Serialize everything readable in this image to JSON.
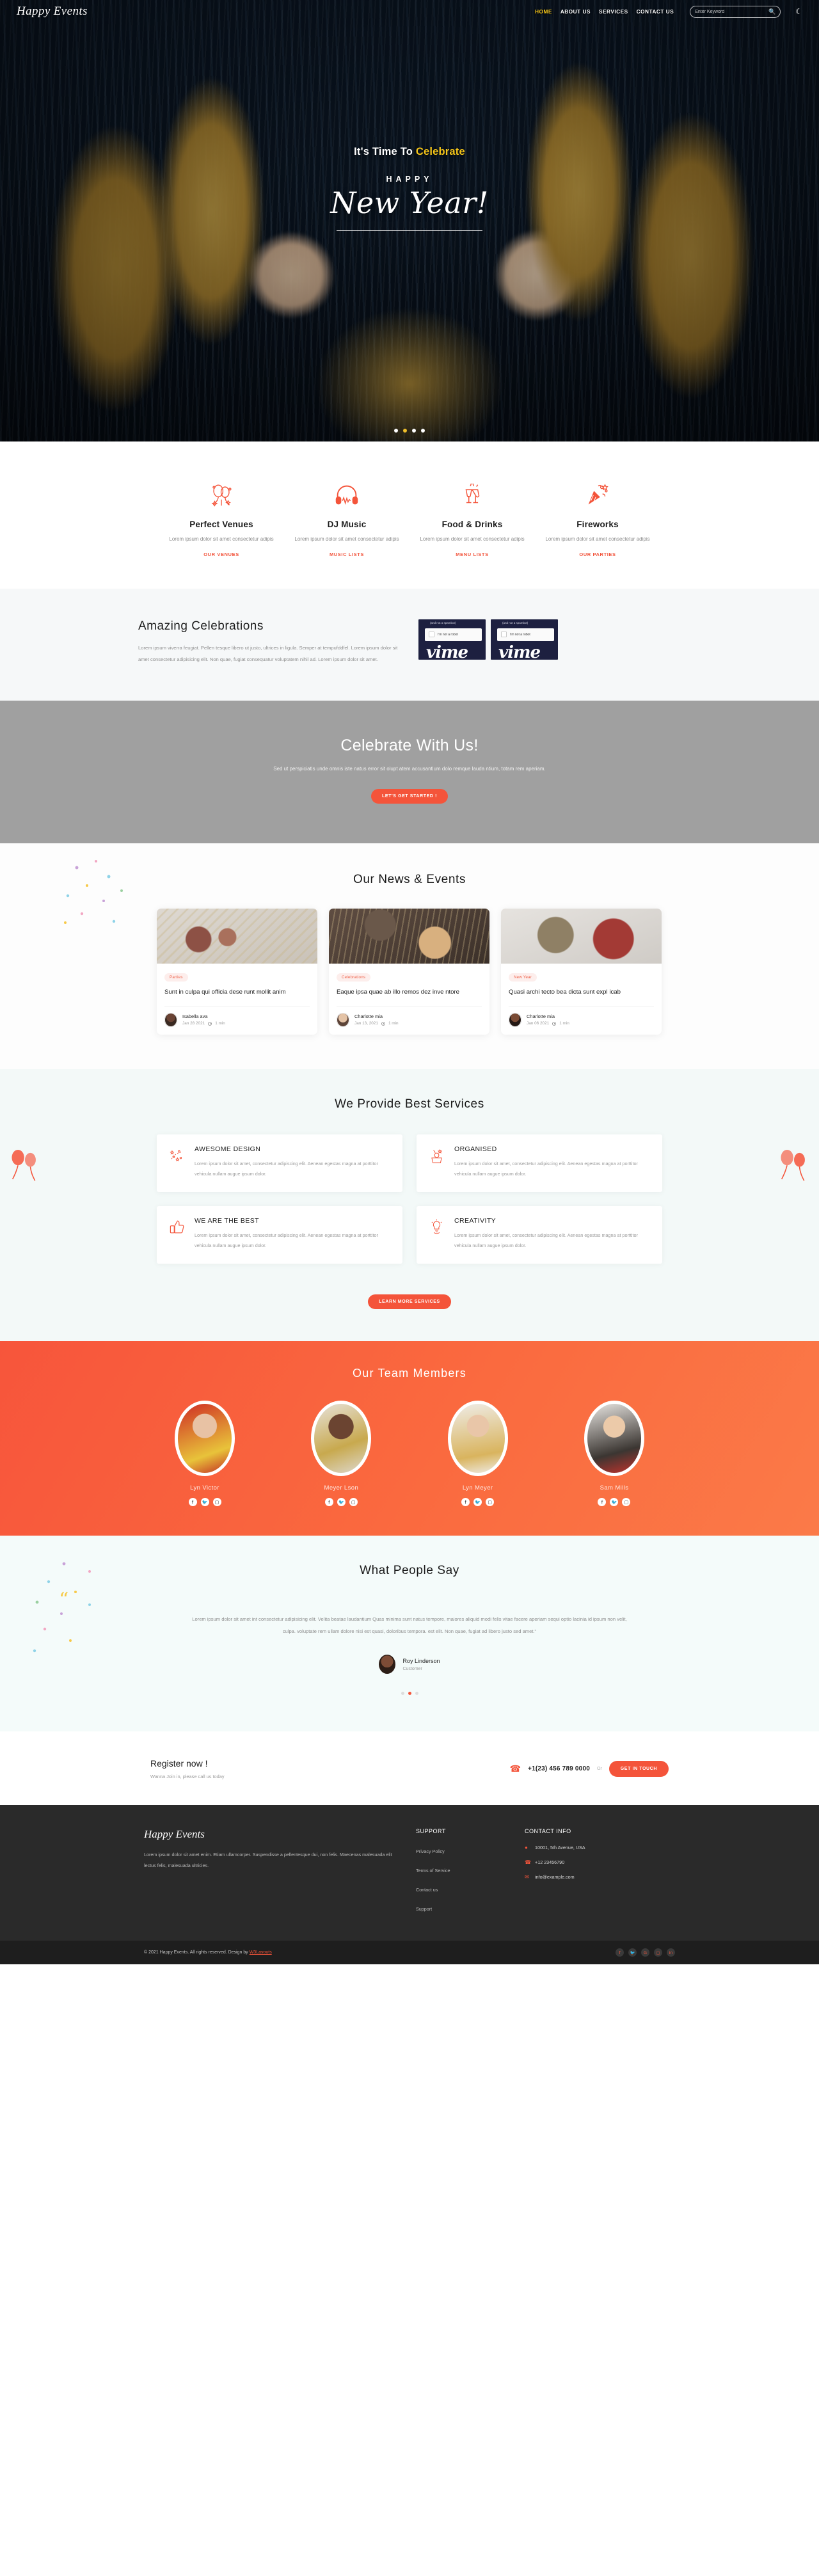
{
  "brand": {
    "name": "Happy Events",
    "accent": "#f4543a",
    "gold": "#f5c518"
  },
  "header": {
    "nav": [
      {
        "label": "HOME",
        "active": true
      },
      {
        "label": "ABOUT US",
        "active": false
      },
      {
        "label": "SERVICES",
        "active": false
      },
      {
        "label": "CONTACT US",
        "active": false
      }
    ],
    "search_placeholder": "Enter Keyword",
    "search_value": "",
    "search_icon": "search-icon",
    "theme_icon": "moon-icon"
  },
  "hero": {
    "eyebrow_pre": "It's Time To ",
    "eyebrow_accent": "Celebrate",
    "happy": "HAPPY",
    "title": "New Year!",
    "slide_count": 4,
    "active_slide": 2
  },
  "features": [
    {
      "icon": "balloons-icon",
      "title": "Perfect Venues",
      "text": "Lorem ipsum dolor sit amet consectetur adipis",
      "link": "OUR VENUES"
    },
    {
      "icon": "headphones-icon",
      "title": "DJ Music",
      "text": "Lorem ipsum dolor sit amet consectetur adipis",
      "link": "MUSIC LISTS"
    },
    {
      "icon": "champagne-glasses-icon",
      "title": "Food & Drinks",
      "text": "Lorem ipsum dolor sit amet consectetur adipis",
      "link": "MENU LISTS"
    },
    {
      "icon": "party-popper-icon",
      "title": "Fireworks",
      "text": "Lorem ipsum dolor sit amet consectetur adipis",
      "link": "OUR PARTIES"
    }
  ],
  "amazing": {
    "title": "Amazing Celebrations",
    "text": "Lorem ipsum viverra feugiat. Pellen tesque libero ut justo, ultrices in ligula. Semper at tempufddfel. Lorem ipsum dolor sit amet consectetur adipisicing elit. Non quae, fugiat consequatur voluptatem nihil ad. Lorem ipsum dolor sit amet.",
    "videos": [
      {
        "overlay_title": "(and not a spambot)",
        "checkbox_label": "I'm not a robot",
        "wordmark": "vime"
      },
      {
        "overlay_title": "(and not a spambot)",
        "checkbox_label": "I'm not a robot",
        "wordmark": "vime"
      }
    ]
  },
  "celebrate": {
    "title": "Celebrate With Us!",
    "text": "Sed ut perspiciatis unde omnis iste natus error sit olupt atem accusantium dolo remque lauda ntium, totam rem aperiam.",
    "button": "LET'S GET STARTED !"
  },
  "news": {
    "title": "Our News & Events",
    "cards": [
      {
        "tag": "Parties",
        "title": "Sunt in culpa qui officia dese runt mollit anim",
        "author": "Isabella ava",
        "date": "Jan 28 2021",
        "read": "1 min"
      },
      {
        "tag": "Celebrations",
        "title": "Eaque ipsa quae ab illo remos dez inve ntore",
        "author": "Charlotte mia",
        "date": "Jan 13, 2021",
        "read": "1 min"
      },
      {
        "tag": "New Year",
        "title": "Quasi archi tecto bea dicta sunt expl icab",
        "author": "Charlotte mia",
        "date": "Jan 06 2021",
        "read": "1 min"
      }
    ]
  },
  "services": {
    "title": "We Provide Best Services",
    "items": [
      {
        "icon": "confetti-icon",
        "title": "AWESOME DESIGN",
        "text": "Lorem ipsum dolor sit amet, consectetur adipiscing elit. Aenean egestas magna at porttitor vehicula nullam augue ipsum dolor."
      },
      {
        "icon": "hand-star-icon",
        "title": "ORGANISED",
        "text": "Lorem ipsum dolor sit amet, consectetur adipiscing elit. Aenean egestas magna at porttitor vehicula nullam augue ipsum dolor."
      },
      {
        "icon": "thumbs-up-icon",
        "title": "WE ARE THE BEST",
        "text": "Lorem ipsum dolor sit amet, consectetur adipiscing elit. Aenean egestas magna at porttitor vehicula nullam augue ipsum dolor."
      },
      {
        "icon": "lightbulb-icon",
        "title": "CREATIVITY",
        "text": "Lorem ipsum dolor sit amet, consectetur adipiscing elit. Aenean egestas magna at porttitor vehicula nullam augue ipsum dolor."
      }
    ],
    "button": "LEARN MORE SERVICES"
  },
  "team": {
    "title": "Our Team Members",
    "members": [
      {
        "name": "Lyn Victor",
        "socials": [
          "f",
          "t",
          "i"
        ]
      },
      {
        "name": "Meyer Lson",
        "socials": [
          "f",
          "t",
          "i"
        ]
      },
      {
        "name": "Lyn Meyer",
        "socials": [
          "f",
          "t",
          "i"
        ]
      },
      {
        "name": "Sam Mills",
        "socials": [
          "f",
          "t",
          "i"
        ]
      }
    ]
  },
  "testimonial": {
    "title": "What People Say",
    "quote_glyph": "“",
    "text": "Lorem ipsum dolor sit amet int consectetur adipisicing elit. Velita beatae laudantium Quas minima sunt natus tempore, maiores aliquid modi felis vitae facere aperiam sequi optio lacinia id ipsum non velit, culpa. voluptate rem ullam dolore nisi est quasi, doloribus tempora. est elit. Non quae, fugiat ad libero justo sed amet.\"",
    "name": "Roy Linderson",
    "role": "Customer",
    "dot_count": 3,
    "active_dot": 2
  },
  "register": {
    "title": "Register now !",
    "subtitle": "Wanna Join in, please call us today",
    "phone_icon": "phone-ringing-icon",
    "phone": "+1(23) 456 789 0000",
    "or": "Or",
    "button": "GET IN TOUCH"
  },
  "footer": {
    "logo": "Happy Events",
    "about": "Lorem ipsum dolor sit amet enim. Etiam ullamcorper. Suspendisse a pellentesque dui, non felis. Maecenas malesuada elit lectus felis, malesuada ultricies.",
    "support_heading": "SUPPORT",
    "support_links": [
      "Privacy Policy",
      "Terms of Service",
      "Contact us",
      "Support"
    ],
    "contact_heading": "CONTACT INFO",
    "contact": [
      {
        "icon": "location-pin-icon",
        "text": "10001, 5th Avenue, USA"
      },
      {
        "icon": "phone-icon",
        "text": "+12 23456790"
      },
      {
        "icon": "envelope-icon",
        "text": "info@example.com"
      }
    ],
    "copyright_pre": "© 2021 Happy Events. All rights reserved. Design by ",
    "copyright_link": "W3Layouts",
    "socials": [
      "f",
      "t",
      "G+",
      "i",
      "in"
    ]
  }
}
